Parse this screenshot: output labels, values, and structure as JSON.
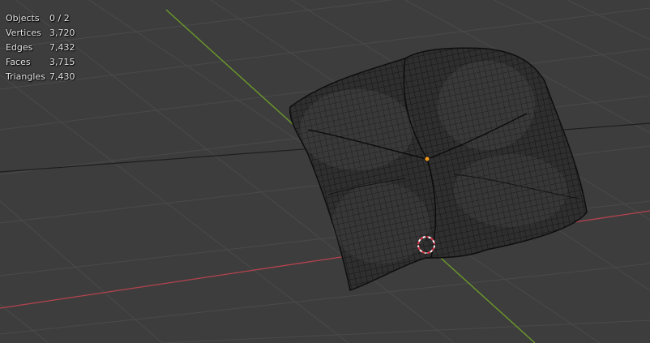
{
  "viewport": {
    "background": "#3d3d3d",
    "x_axis_color": "#b5434f",
    "y_axis_color": "#6c9a2a"
  },
  "stats": {
    "rows": [
      {
        "label": "Objects",
        "value": "0 / 2"
      },
      {
        "label": "Vertices",
        "value": "3,720"
      },
      {
        "label": "Edges",
        "value": "7,432"
      },
      {
        "label": "Faces",
        "value": "3,715"
      },
      {
        "label": "Triangles",
        "value": "7,430"
      }
    ]
  },
  "icons": {
    "origin": "object-origin-dot",
    "cursor": "3d-cursor-icon"
  }
}
